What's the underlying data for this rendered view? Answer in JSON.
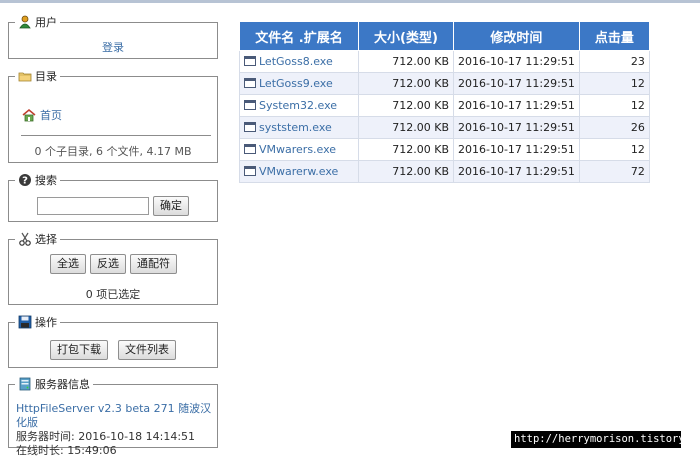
{
  "user_panel": {
    "legend": "用户",
    "login_link": "登录"
  },
  "dir_panel": {
    "legend": "目录",
    "home_link": "首页",
    "stats": "0 个子目录, 6 个文件, 4.17 MB"
  },
  "search_panel": {
    "legend": "搜索",
    "input_value": "",
    "submit_label": "确定"
  },
  "select_panel": {
    "legend": "选择",
    "select_all": "全选",
    "invert": "反选",
    "wildcard": "通配符",
    "selected_count": "0 项已选定"
  },
  "action_panel": {
    "legend": "操作",
    "download_zip": "打包下载",
    "file_list": "文件列表"
  },
  "server_panel": {
    "legend": "服务器信息",
    "version_link": "HttpFileServer v2.3 beta 271 随波汉化版",
    "server_time": "服务器时间: 2016-10-18 14:14:51",
    "uptime": "在线时长: 15:49:06"
  },
  "file_table": {
    "headers": {
      "name": "文件名 .扩展名",
      "size": "大小(类型)",
      "modified": "修改时间",
      "hits": "点击量"
    },
    "rows": [
      {
        "name": "LetGoss8.exe",
        "size": "712.00 KB",
        "modified": "2016-10-17 11:29:51",
        "hits": "23"
      },
      {
        "name": "LetGoss9.exe",
        "size": "712.00 KB",
        "modified": "2016-10-17 11:29:51",
        "hits": "12"
      },
      {
        "name": "System32.exe",
        "size": "712.00 KB",
        "modified": "2016-10-17 11:29:51",
        "hits": "12"
      },
      {
        "name": "syststem.exe",
        "size": "712.00 KB",
        "modified": "2016-10-17 11:29:51",
        "hits": "26"
      },
      {
        "name": "VMwarers.exe",
        "size": "712.00 KB",
        "modified": "2016-10-17 11:29:51",
        "hits": "12"
      },
      {
        "name": "VMwarerw.exe",
        "size": "712.00 KB",
        "modified": "2016-10-17 11:29:51",
        "hits": "72"
      }
    ]
  },
  "watermark": "http://herrymorison.tistory.com",
  "colors": {
    "header_bg": "#3c78c6",
    "link": "#3b6ea6",
    "alt_row": "#eef1fa"
  }
}
